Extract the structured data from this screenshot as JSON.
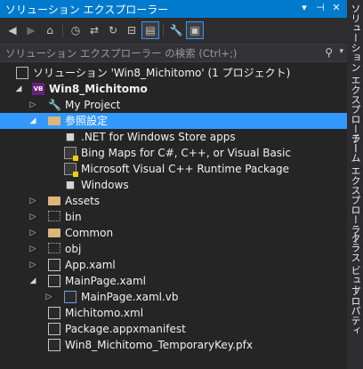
{
  "window": {
    "title": "ソリューション エクスプローラー"
  },
  "toolbar": {
    "buttons": [
      "back-icon",
      "forward-icon",
      "home-icon",
      "history-icon",
      "sync-icon",
      "refresh-icon",
      "collapse-icon",
      "show-all-icon",
      "properties-icon",
      "preview-icon"
    ]
  },
  "search": {
    "placeholder": "ソリューション エクスプローラー の検索 (Ctrl+;)"
  },
  "tree": {
    "solution": "ソリューション 'Win8_Michitomo' (1 プロジェクト)",
    "project": "Win8_Michitomo",
    "items": {
      "my_project": "My Project",
      "references": "参照設定",
      "ref_net": ".NET for Windows Store apps",
      "ref_bing": "Bing Maps for C#, C++, or Visual Basic",
      "ref_vcpp": "Microsoft Visual C++ Runtime Package",
      "ref_windows": "Windows",
      "assets": "Assets",
      "bin": "bin",
      "common": "Common",
      "obj": "obj",
      "app_xaml": "App.xaml",
      "mainpage_xaml": "MainPage.xaml",
      "mainpage_vb": "MainPage.xaml.vb",
      "michitomo_xml": "Michitomo.xml",
      "manifest": "Package.appxmanifest",
      "pfx": "Win8_Michitomo_TemporaryKey.pfx"
    }
  },
  "side_tabs": {
    "solution_explorer": "ソリューション エクスプローラー",
    "team_explorer": "チーム エクスプローラー",
    "class_view": "クラス ビュー",
    "properties": "プロパティ"
  },
  "colors": {
    "title_bar": "#007acc",
    "selection": "#3399ff",
    "highlight_box": "#c9245c"
  }
}
